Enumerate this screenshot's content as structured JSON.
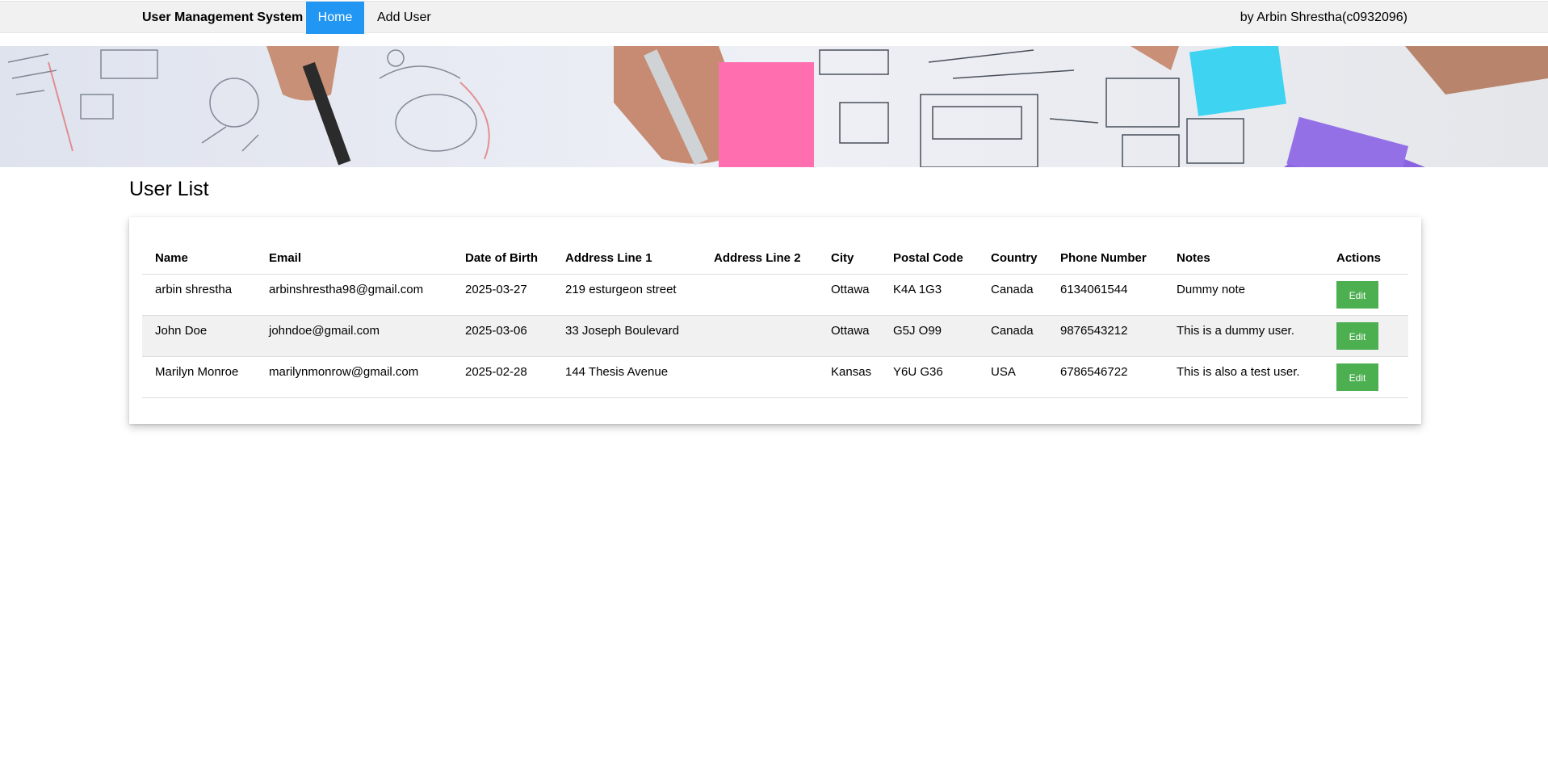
{
  "nav": {
    "brand": "User Management System",
    "home": "Home",
    "add_user": "Add User",
    "author": "by Arbin Shrestha(c0932096)"
  },
  "page": {
    "title": "User List"
  },
  "table": {
    "headers": [
      "Name",
      "Email",
      "Date of Birth",
      "Address Line 1",
      "Address Line 2",
      "City",
      "Postal Code",
      "Country",
      "Phone Number",
      "Notes",
      "Actions"
    ],
    "rows": [
      {
        "name": "arbin shrestha",
        "email": "arbinshrestha98@gmail.com",
        "dob": "2025-03-27",
        "address1": "219 esturgeon street",
        "address2": "",
        "city": "Ottawa",
        "postal": "K4A 1G3",
        "country": "Canada",
        "phone": "6134061544",
        "notes": "Dummy note",
        "action": "Edit"
      },
      {
        "name": "John Doe",
        "email": "johndoe@gmail.com",
        "dob": "2025-03-06",
        "address1": "33 Joseph Boulevard",
        "address2": "",
        "city": "Ottawa",
        "postal": "G5J O99",
        "country": "Canada",
        "phone": "9876543212",
        "notes": "This is a dummy user.",
        "action": "Edit"
      },
      {
        "name": "Marilyn Monroe",
        "email": "marilynmonrow@gmail.com",
        "dob": "2025-02-28",
        "address1": "144 Thesis Avenue",
        "address2": "",
        "city": "Kansas",
        "postal": "Y6U G36",
        "country": "USA",
        "phone": "6786546722",
        "notes": "This is also a test user.",
        "action": "Edit"
      }
    ]
  },
  "colors": {
    "nav_active": "#2196f3",
    "edit_button": "#4caf50",
    "topbar": "#f1f1f1"
  }
}
